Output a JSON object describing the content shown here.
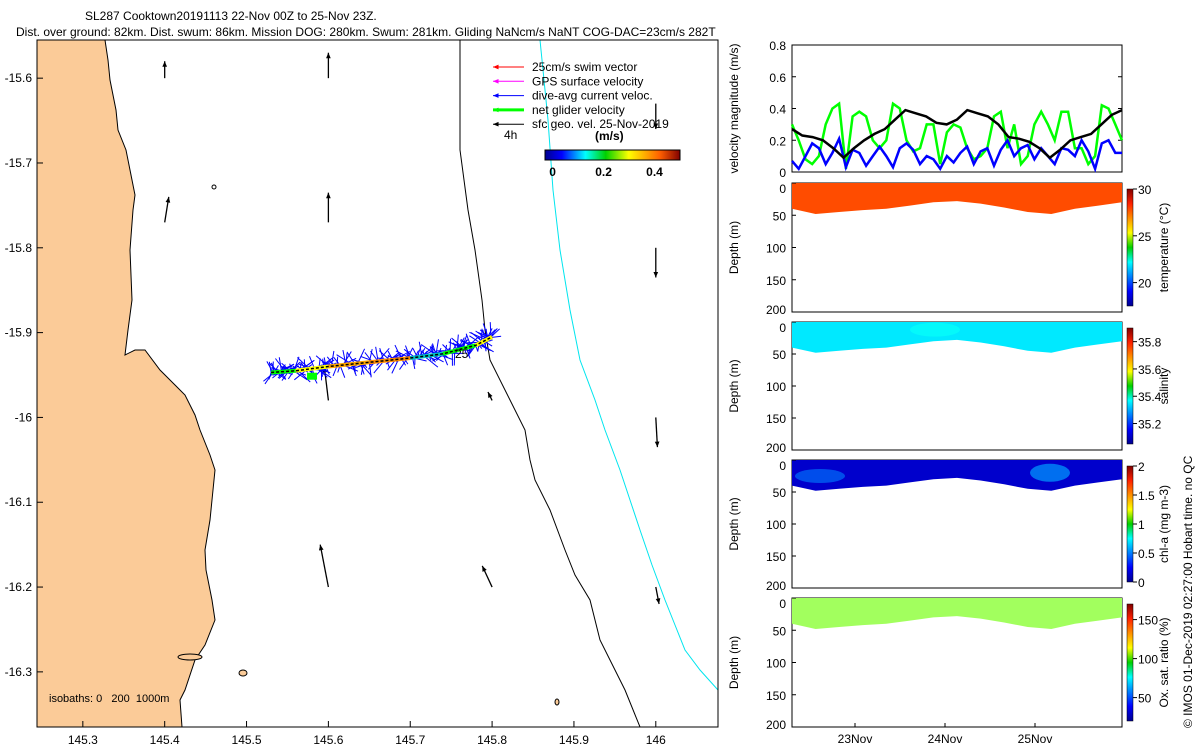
{
  "title": {
    "line1": "SL287 Cooktown20191113 22-Nov 00Z to 25-Nov 23Z.",
    "line2": "Dist. over ground: 82km. Dist. swum: 86km. Mission DOG: 280km. Swum: 281km. Gliding NaNcm/s NaNT COG-DAC=23cm/s 282T"
  },
  "footer": "© IMOS 01-Dec-2019 02:27:00 Hobart time. no QC",
  "colors": {
    "land": "#fbcb98",
    "swim": "#ff0000",
    "gps": "#ff00ff",
    "dac": "#0000ff",
    "net": "#00ff00",
    "geo": "#000000",
    "isobath200": "#000000",
    "isobath1000": "#00e5ee"
  },
  "chart_data": [
    {
      "type": "map",
      "name": "track-map",
      "xlim": [
        145.244,
        146.076
      ],
      "ylim": [
        -16.365,
        -15.555
      ],
      "xticks": [
        "145.3",
        "145.4",
        "145.5",
        "145.6",
        "145.7",
        "145.8",
        "145.9",
        "146"
      ],
      "xtick_values": [
        145.3,
        145.4,
        145.5,
        145.6,
        145.7,
        145.8,
        145.9,
        146.0
      ],
      "yticks": [
        "-15.6",
        "-15.7",
        "-15.8",
        "-15.9",
        "-16",
        "-16.1",
        "-16.2",
        "-16.3"
      ],
      "ytick_values": [
        -15.6,
        -15.7,
        -15.8,
        -15.9,
        -16.0,
        -16.1,
        -16.2,
        -16.3
      ],
      "legend": [
        {
          "label": "25cm/s swim vector",
          "color": "#ff0000"
        },
        {
          "label": "GPS surface velocity",
          "color": "#ff00ff"
        },
        {
          "label": "dive-avg current veloc.",
          "color": "#0000ff"
        },
        {
          "label": "net glider velocity",
          "color": "#00ff00"
        },
        {
          "label": "sfc geo. vel. 25-Nov-2019",
          "color": "#000000"
        }
      ],
      "time_marker": "4h",
      "track_label": "25",
      "colorbar": {
        "label": "(m/s)",
        "ticks": [
          "0",
          "0.2",
          "0.4"
        ],
        "tick_values": [
          0,
          0.2,
          0.4
        ],
        "range": [
          -0.03,
          0.5
        ]
      },
      "isobaths_label": "isobaths: 0   200  1000m",
      "track": [
        [
          145.53,
          -15.947
        ],
        [
          145.56,
          -15.945
        ],
        [
          145.6,
          -15.94
        ],
        [
          145.65,
          -15.935
        ],
        [
          145.7,
          -15.93
        ],
        [
          145.74,
          -15.925
        ],
        [
          145.78,
          -15.915
        ],
        [
          145.8,
          -15.905
        ]
      ],
      "geo_vectors": [
        {
          "lon": 145.4,
          "lat": -15.6,
          "u": 0,
          "v": 0.02
        },
        {
          "lon": 145.6,
          "lat": -15.6,
          "u": 0,
          "v": 0.03
        },
        {
          "lon": 145.4,
          "lat": -15.77,
          "u": 0.005,
          "v": 0.03
        },
        {
          "lon": 145.6,
          "lat": -15.77,
          "u": 0,
          "v": 0.035
        },
        {
          "lon": 146.0,
          "lat": -15.8,
          "u": 0,
          "v": -0.035
        },
        {
          "lon": 145.6,
          "lat": -15.98,
          "u": -0.005,
          "v": 0.04
        },
        {
          "lon": 145.8,
          "lat": -15.98,
          "u": -0.005,
          "v": 0.01
        },
        {
          "lon": 146.0,
          "lat": -16.0,
          "u": 0.002,
          "v": -0.035
        },
        {
          "lon": 145.6,
          "lat": -16.2,
          "u": -0.01,
          "v": 0.05
        },
        {
          "lon": 145.8,
          "lat": -16.2,
          "u": -0.012,
          "v": 0.025
        },
        {
          "lon": 146.0,
          "lat": -16.2,
          "u": 0.004,
          "v": -0.02
        },
        {
          "lon": 146.0,
          "lat": -15.63,
          "u": 0,
          "v": -0.03
        }
      ]
    },
    {
      "type": "line",
      "name": "velocity-magnitude",
      "ylabel": "velocity magnitude (m/s)",
      "ylim": [
        0,
        0.8
      ],
      "yticks": [
        "0",
        "0.2",
        "0.4",
        "0.6",
        "0.8"
      ],
      "ytick_values": [
        0,
        0.2,
        0.4,
        0.6,
        0.8
      ],
      "series": [
        {
          "name": "net glider velocity",
          "color": "#00ff00",
          "values": [
            0.3,
            0.2,
            0.08,
            0.05,
            0.1,
            0.3,
            0.4,
            0.43,
            0.02,
            0.35,
            0.38,
            0.35,
            0.2,
            0.15,
            0.2,
            0.43,
            0.4,
            0.2,
            0.13,
            0.15,
            0.3,
            0.3,
            0.05,
            0.25,
            0.3,
            0.28,
            0.15,
            0.08,
            0.1,
            0.15,
            0.35,
            0.38,
            0.15,
            0.3,
            0.05,
            0.1,
            0.3,
            0.38,
            0.3,
            0.2,
            0.38,
            0.38,
            0.15,
            0.15,
            0.05,
            0.1,
            0.42,
            0.4,
            0.3,
            0.2
          ]
        },
        {
          "name": "dive-avg current",
          "color": "#0000ff",
          "values": [
            0.07,
            0.02,
            0.1,
            0.18,
            0.15,
            0.05,
            0.12,
            0.21,
            0.03,
            0.14,
            0.12,
            0.04,
            0.1,
            0.16,
            0.1,
            0.03,
            0.15,
            0.18,
            0.14,
            0.05,
            0.1,
            0.08,
            0.02,
            0.1,
            0.06,
            0.12,
            0.16,
            0.05,
            0.13,
            0.15,
            0.04,
            0.14,
            0.2,
            0.1,
            0.15,
            0.17,
            0.08,
            0.15,
            0.1,
            0.05,
            0.15,
            0.14,
            0.1,
            0.2,
            0.13,
            0.02,
            0.18,
            0.2,
            0.12,
            0.12
          ]
        },
        {
          "name": "sfc geo. vel.",
          "color": "#000000",
          "values": [
            0.27,
            0.23,
            0.22,
            0.2,
            0.15,
            0.09,
            0.15,
            0.2,
            0.24,
            0.27,
            0.33,
            0.39,
            0.37,
            0.35,
            0.31,
            0.3,
            0.33,
            0.39,
            0.37,
            0.35,
            0.3,
            0.22,
            0.21,
            0.19,
            0.15,
            0.09,
            0.14,
            0.2,
            0.22,
            0.24,
            0.3,
            0.36,
            0.39
          ]
        }
      ]
    },
    {
      "type": "heatmap",
      "name": "temperature",
      "ylabel": "Depth (m)",
      "cbar_label": "temperature (°C)",
      "ylim": [
        200,
        0
      ],
      "yticks": [
        "0",
        "50",
        "100",
        "150",
        "200"
      ],
      "cbar_ticks": [
        "20",
        "25",
        "30"
      ],
      "cbar_tick_values": [
        20,
        25,
        30
      ],
      "cbar_range": [
        17.5,
        30
      ],
      "value": 27.5,
      "max_depth": [
        40,
        48,
        45,
        42,
        40,
        35,
        30,
        28,
        32,
        38,
        45,
        48,
        40,
        35,
        30
      ]
    },
    {
      "type": "heatmap",
      "name": "salinity",
      "ylabel": "Depth (m)",
      "cbar_label": "salinity",
      "ylim": [
        200,
        0
      ],
      "yticks": [
        "0",
        "50",
        "100",
        "150",
        "200"
      ],
      "cbar_ticks": [
        "35.2",
        "35.4",
        "35.6",
        "35.8"
      ],
      "cbar_tick_values": [
        35.2,
        35.4,
        35.6,
        35.8
      ],
      "cbar_range": [
        35.05,
        35.9
      ],
      "value": 35.35,
      "max_depth": [
        40,
        48,
        45,
        42,
        40,
        35,
        30,
        28,
        32,
        38,
        45,
        48,
        40,
        35,
        30
      ]
    },
    {
      "type": "heatmap",
      "name": "chlorophyll",
      "ylabel": "Depth (m)",
      "cbar_label": "chl-a (mg m-3)",
      "ylim": [
        200,
        0
      ],
      "yticks": [
        "0",
        "50",
        "100",
        "150",
        "200"
      ],
      "cbar_ticks": [
        "0",
        "0.5",
        "1",
        "1.5",
        "2"
      ],
      "cbar_tick_values": [
        0,
        0.5,
        1,
        1.5,
        2
      ],
      "cbar_range": [
        0,
        2
      ],
      "value": 0.15,
      "max_depth": [
        40,
        48,
        45,
        42,
        40,
        35,
        30,
        28,
        32,
        38,
        45,
        48,
        40,
        35,
        30
      ]
    },
    {
      "type": "heatmap",
      "name": "oxygen",
      "ylabel": "Depth (m)",
      "cbar_label": "Ox. sat. ratio (%)",
      "ylim": [
        200,
        0
      ],
      "yticks": [
        "0",
        "50",
        "100",
        "150",
        "200"
      ],
      "cbar_ticks": [
        "50",
        "100",
        "150"
      ],
      "cbar_tick_values": [
        50,
        100,
        150
      ],
      "cbar_range": [
        20,
        170
      ],
      "value": 100,
      "max_depth": [
        40,
        48,
        45,
        42,
        40,
        35,
        30,
        28,
        32,
        38,
        45,
        48,
        40,
        35,
        30
      ]
    },
    {
      "type": "axis",
      "name": "time-axis",
      "xticks": [
        "23Nov",
        "24Nov",
        "25Nov"
      ]
    }
  ]
}
